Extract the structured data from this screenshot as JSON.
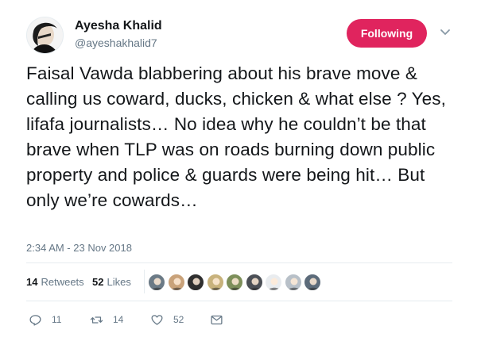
{
  "user": {
    "name": "Ayesha Khalid",
    "handle": "@ayeshakhalid7"
  },
  "follow_button": {
    "label": "Following",
    "color": "#e0245e"
  },
  "tweet": {
    "text": "Faisal Vawda blabbering about his brave move & calling us coward, ducks, chicken & what else ? Yes, lifafa journalists… No idea why he couldn’t be that brave when TLP was on roads burning down public property and police & guards were being hit… But only we’re cowards…",
    "timestamp": "2:34 AM - 23 Nov 2018"
  },
  "stats": {
    "retweets_count": "14",
    "retweets_label": "Retweets",
    "likes_count": "52",
    "likes_label": "Likes"
  },
  "likers": [
    {
      "icon": "liker-avatar-1",
      "color": "#6b7a86"
    },
    {
      "icon": "liker-avatar-2",
      "color": "#c9a27a"
    },
    {
      "icon": "liker-avatar-3",
      "color": "#2f2f2f"
    },
    {
      "icon": "liker-avatar-4",
      "color": "#c8b27c"
    },
    {
      "icon": "liker-avatar-5",
      "color": "#7d8f5a"
    },
    {
      "icon": "liker-avatar-6",
      "color": "#4b4f56"
    },
    {
      "icon": "liker-avatar-7",
      "color": "#e9ecef"
    },
    {
      "icon": "liker-avatar-8",
      "color": "#b8c0c8"
    },
    {
      "icon": "liker-avatar-9",
      "color": "#5c6b7a"
    }
  ],
  "actions": {
    "reply_count": "11",
    "retweet_count": "14",
    "like_count": "52"
  }
}
